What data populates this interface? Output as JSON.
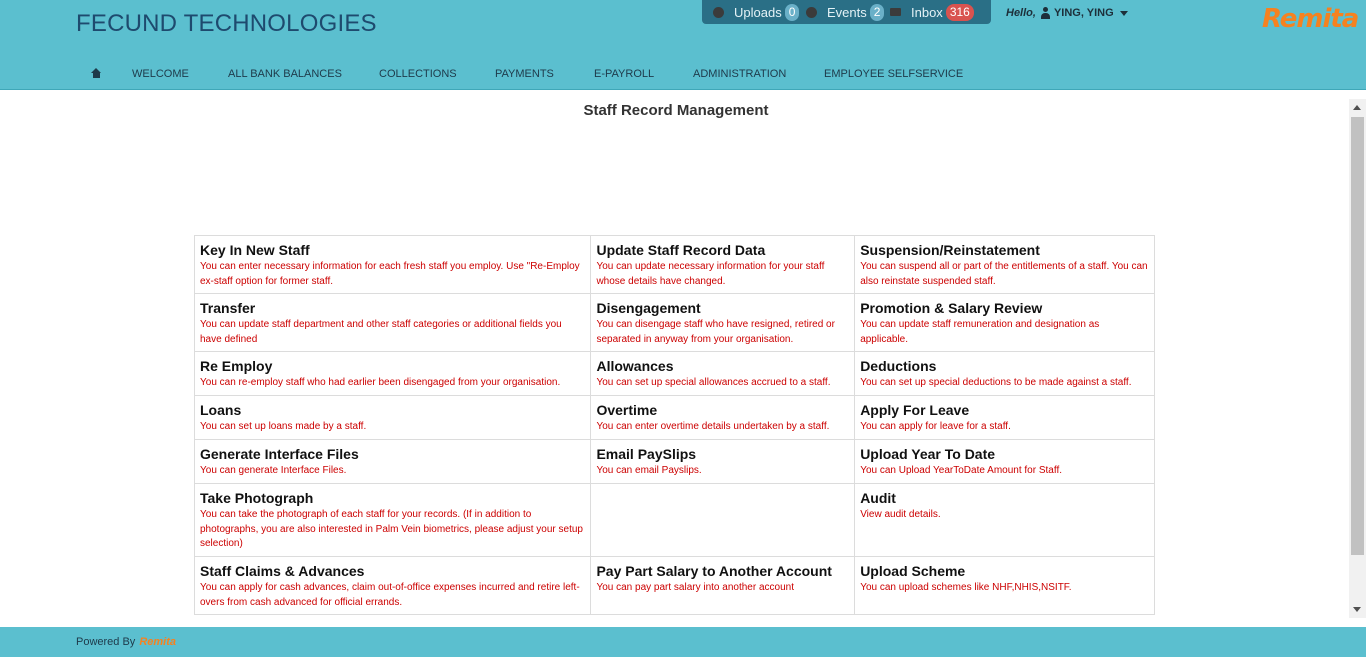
{
  "header": {
    "brand": "FECUND TECHNOLOGIES",
    "uploads_label": "Uploads",
    "uploads_count": "0",
    "events_label": "Events",
    "events_count": "2",
    "inbox_label": "Inbox",
    "inbox_count": "316",
    "hello": "Hello,",
    "user_name": "YING, YING",
    "logo_text": "Remita"
  },
  "nav": {
    "items": [
      "WELCOME",
      "ALL BANK BALANCES",
      "COLLECTIONS",
      "PAYMENTS",
      "E-PAYROLL",
      "ADMINISTRATION",
      "EMPLOYEE SELFSERVICE"
    ]
  },
  "page": {
    "title": "Staff Record Management"
  },
  "cells": [
    {
      "title": "Key In New Staff",
      "desc": "You can enter necessary information for each fresh staff you employ. Use \"Re-Employ ex-staff option for former staff."
    },
    {
      "title": "Update Staff Record Data",
      "desc": "You can update necessary information for your staff whose details have changed."
    },
    {
      "title": "Suspension/Reinstatement",
      "desc": "You can suspend all or part of the entitlements of a staff. You can also reinstate suspended staff."
    },
    {
      "title": "Transfer",
      "desc": "You can update staff department and other staff categories or additional fields you have defined"
    },
    {
      "title": "Disengagement",
      "desc": "You can disengage staff who have resigned, retired or separated in anyway from your organisation."
    },
    {
      "title": "Promotion & Salary Review",
      "desc": "You can update staff remuneration and designation as applicable."
    },
    {
      "title": "Re Employ",
      "desc": "You can re-employ staff who had earlier been disengaged from your organisation."
    },
    {
      "title": "Allowances",
      "desc": "You can set up special allowances accrued to a staff."
    },
    {
      "title": "Deductions",
      "desc": "You can set up special deductions to be made against a staff."
    },
    {
      "title": "Loans",
      "desc": "You can set up loans made by a staff."
    },
    {
      "title": "Overtime",
      "desc": "You can enter overtime details undertaken by a staff."
    },
    {
      "title": "Apply For Leave",
      "desc": "You can apply for leave for a staff."
    },
    {
      "title": "Generate Interface Files",
      "desc": "You can generate Interface Files."
    },
    {
      "title": "Email PaySlips",
      "desc": "You can email Payslips."
    },
    {
      "title": "Upload Year To Date",
      "desc": "You can Upload YearToDate Amount for Staff."
    },
    {
      "title": "Take Photograph",
      "desc": "You can take the photograph of each staff for your records. (If in addition to photographs, you are also interested in Palm Vein biometrics, please adjust your setup selection)"
    },
    {
      "title": "",
      "desc": ""
    },
    {
      "title": "Audit",
      "desc": "View audit details."
    },
    {
      "title": "Staff Claims & Advances",
      "desc": "You can apply for cash advances, claim out-of-office expenses incurred and retire left-overs from cash advanced for official errands."
    },
    {
      "title": "Pay Part Salary to Another Account",
      "desc": "You can pay part salary into another account"
    },
    {
      "title": "Upload Scheme",
      "desc": "You can upload schemes like NHF,NHIS,NSITF."
    }
  ],
  "footer": {
    "powered_by": "Powered By",
    "logo_text": "Remita"
  },
  "colors": {
    "header_bg": "#5bbfcf",
    "brand_text": "#1e4a6e",
    "desc_text": "#cc0000",
    "logo": "#f58220"
  },
  "icons": [
    "home-icon",
    "upload-icon",
    "events-icon",
    "inbox-icon",
    "user-icon",
    "chevron-down-icon"
  ]
}
